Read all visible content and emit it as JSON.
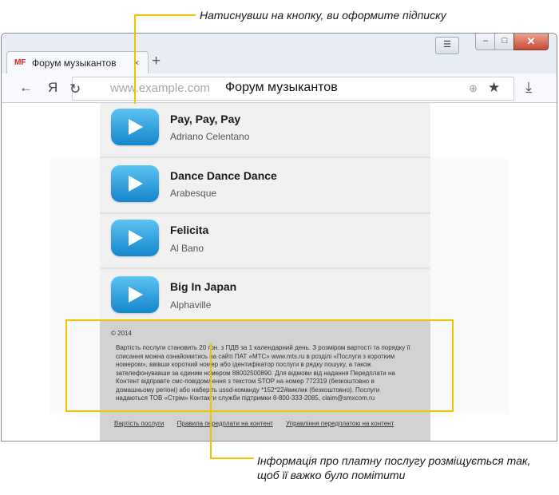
{
  "annotations": {
    "top": "Натиснувши на кнопку, ви оформите підписку",
    "bottom": "Інформація про платну послугу розміщується так, щоб її важко було помітити"
  },
  "colors": {
    "annotation_line": "#f2c200",
    "play_button": "#1e9be0",
    "close_button": "#c74a32"
  },
  "browser": {
    "tab": {
      "logo": "MF",
      "title": "Форум музыкантов",
      "close": "×"
    },
    "new_tab": "+",
    "nav": {
      "back": "←",
      "yandex": "Я",
      "reload": "↻"
    },
    "address": {
      "domain": "www.example.com",
      "page_title": "Форум музыкантов"
    },
    "icons": [
      "globe-icon",
      "star-icon",
      "download-icon"
    ]
  },
  "songs": [
    {
      "title": "Pay, Pay, Pay",
      "artist": "Adriano Celentano"
    },
    {
      "title": "Dance Dance Dance",
      "artist": "Arabesque"
    },
    {
      "title": "Felicita",
      "artist": "Al Bano"
    },
    {
      "title": "Big In Japan",
      "artist": "Alphaville"
    }
  ],
  "footer": {
    "copyright": "© 2014",
    "legal": "Вартість послуги становить 20 грн. з ПДВ за 1 календарний день. З розміром вартості та порядку її списання можна ознайомитись на сайті ПАТ «МТС» www.mts.ru в розділі «Послуги з коротким номером», ввівши короткий номер або ідентифікатор послуги в рядку пошуку, а також зателефонувавши за єдиним номером 88002500890. Для відмови від надання Передплати на Контент відправте смс-повідомлення з текстом STOP на номер 772319 (безкоштовно в домашньому регіоні) або наберіть ussd-команду *152*22#виклик (безкоштовно). Послуги надаються ТОВ «Стрім» Контакти служби підтримки 8-800-333-2085, claim@smxcom.ru",
    "links": [
      "Вартість послуги",
      "Правила передплати на контент",
      "Управління передплатою на контент"
    ]
  }
}
